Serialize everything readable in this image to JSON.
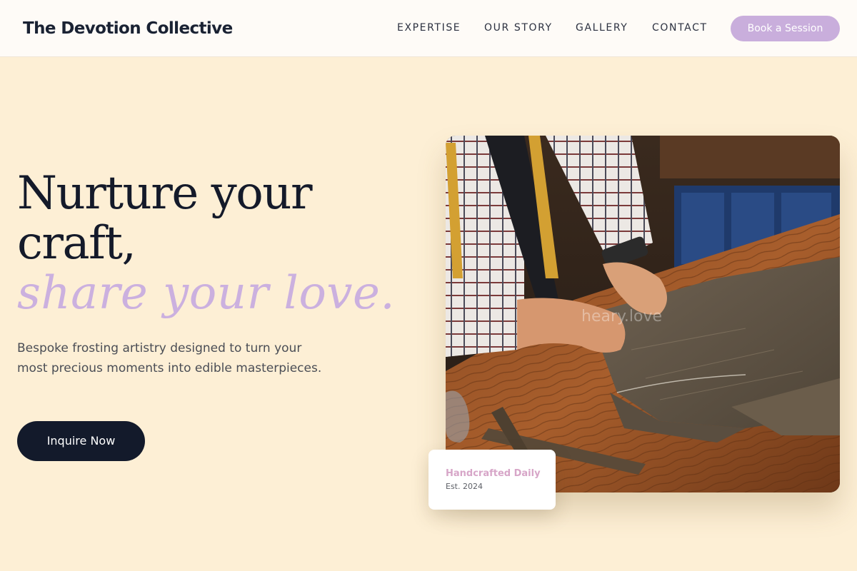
{
  "header": {
    "logo": "The Devotion Collective",
    "nav": [
      "EXPERTISE",
      "OUR STORY",
      "GALLERY",
      "CONTACT"
    ],
    "book_label": "Book a Session"
  },
  "hero": {
    "title_line1": "Nurture your",
    "title_line2": "craft,",
    "title_accent": "share your love.",
    "subtitle": "Bespoke frosting artistry designed to turn your most precious moments into edible masterpieces.",
    "cta_label": "Inquire Now"
  },
  "image": {
    "watermark": "heary.love"
  },
  "badge": {
    "title": "Handcrafted Daily",
    "subtitle": "Est. 2024"
  },
  "colors": {
    "background": "#fdefd5",
    "header_bg": "#fefbf7",
    "accent_lavender": "#c9aedc",
    "dark_navy": "#131a2b",
    "badge_pink": "#d7a6c8"
  }
}
